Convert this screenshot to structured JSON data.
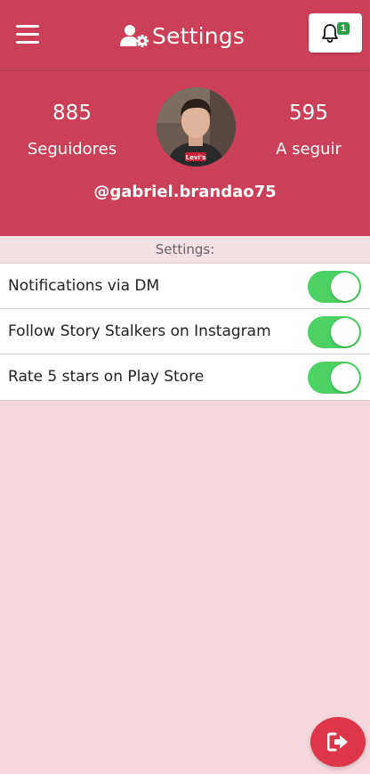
{
  "header": {
    "title": "Settings",
    "title_icon": "user-gear-icon",
    "menu_icon": "hamburger-menu-icon",
    "notification_icon": "bell-icon",
    "notification_count": "1"
  },
  "profile": {
    "followers_count": "885",
    "followers_label": "Seguidores",
    "following_count": "595",
    "following_label": "A seguir",
    "username": "@gabriel.brandao75"
  },
  "settings": {
    "section_title": "Settings:",
    "items": [
      {
        "label": "Notifications via DM",
        "enabled": true
      },
      {
        "label": "Follow Story Stalkers on Instagram",
        "enabled": true
      },
      {
        "label": "Rate 5 stars on Play Store",
        "enabled": true
      }
    ]
  },
  "logout": {
    "icon": "logout-icon"
  },
  "colors": {
    "primary": "#cc3f58",
    "background": "#f5d8dd",
    "toggle_on": "#4bd263",
    "badge": "#2e9e4a",
    "fab": "#dd3549"
  }
}
